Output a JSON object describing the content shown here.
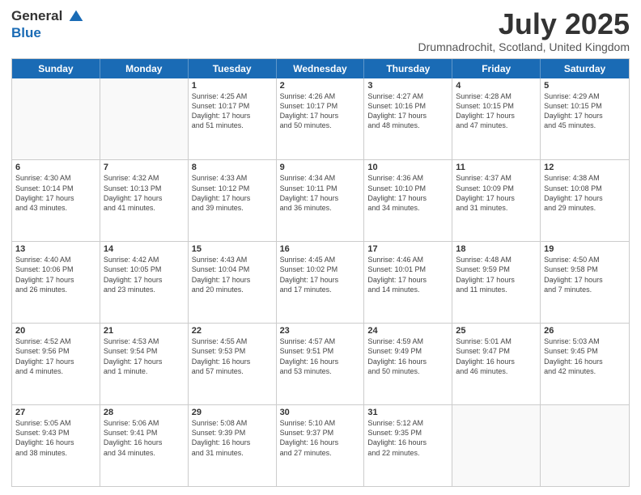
{
  "logo": {
    "general": "General",
    "blue": "Blue"
  },
  "title": "July 2025",
  "location": "Drumnadrochit, Scotland, United Kingdom",
  "days": [
    "Sunday",
    "Monday",
    "Tuesday",
    "Wednesday",
    "Thursday",
    "Friday",
    "Saturday"
  ],
  "weeks": [
    [
      {
        "day": "",
        "info": ""
      },
      {
        "day": "",
        "info": ""
      },
      {
        "day": "1",
        "info": "Sunrise: 4:25 AM\nSunset: 10:17 PM\nDaylight: 17 hours\nand 51 minutes."
      },
      {
        "day": "2",
        "info": "Sunrise: 4:26 AM\nSunset: 10:17 PM\nDaylight: 17 hours\nand 50 minutes."
      },
      {
        "day": "3",
        "info": "Sunrise: 4:27 AM\nSunset: 10:16 PM\nDaylight: 17 hours\nand 48 minutes."
      },
      {
        "day": "4",
        "info": "Sunrise: 4:28 AM\nSunset: 10:15 PM\nDaylight: 17 hours\nand 47 minutes."
      },
      {
        "day": "5",
        "info": "Sunrise: 4:29 AM\nSunset: 10:15 PM\nDaylight: 17 hours\nand 45 minutes."
      }
    ],
    [
      {
        "day": "6",
        "info": "Sunrise: 4:30 AM\nSunset: 10:14 PM\nDaylight: 17 hours\nand 43 minutes."
      },
      {
        "day": "7",
        "info": "Sunrise: 4:32 AM\nSunset: 10:13 PM\nDaylight: 17 hours\nand 41 minutes."
      },
      {
        "day": "8",
        "info": "Sunrise: 4:33 AM\nSunset: 10:12 PM\nDaylight: 17 hours\nand 39 minutes."
      },
      {
        "day": "9",
        "info": "Sunrise: 4:34 AM\nSunset: 10:11 PM\nDaylight: 17 hours\nand 36 minutes."
      },
      {
        "day": "10",
        "info": "Sunrise: 4:36 AM\nSunset: 10:10 PM\nDaylight: 17 hours\nand 34 minutes."
      },
      {
        "day": "11",
        "info": "Sunrise: 4:37 AM\nSunset: 10:09 PM\nDaylight: 17 hours\nand 31 minutes."
      },
      {
        "day": "12",
        "info": "Sunrise: 4:38 AM\nSunset: 10:08 PM\nDaylight: 17 hours\nand 29 minutes."
      }
    ],
    [
      {
        "day": "13",
        "info": "Sunrise: 4:40 AM\nSunset: 10:06 PM\nDaylight: 17 hours\nand 26 minutes."
      },
      {
        "day": "14",
        "info": "Sunrise: 4:42 AM\nSunset: 10:05 PM\nDaylight: 17 hours\nand 23 minutes."
      },
      {
        "day": "15",
        "info": "Sunrise: 4:43 AM\nSunset: 10:04 PM\nDaylight: 17 hours\nand 20 minutes."
      },
      {
        "day": "16",
        "info": "Sunrise: 4:45 AM\nSunset: 10:02 PM\nDaylight: 17 hours\nand 17 minutes."
      },
      {
        "day": "17",
        "info": "Sunrise: 4:46 AM\nSunset: 10:01 PM\nDaylight: 17 hours\nand 14 minutes."
      },
      {
        "day": "18",
        "info": "Sunrise: 4:48 AM\nSunset: 9:59 PM\nDaylight: 17 hours\nand 11 minutes."
      },
      {
        "day": "19",
        "info": "Sunrise: 4:50 AM\nSunset: 9:58 PM\nDaylight: 17 hours\nand 7 minutes."
      }
    ],
    [
      {
        "day": "20",
        "info": "Sunrise: 4:52 AM\nSunset: 9:56 PM\nDaylight: 17 hours\nand 4 minutes."
      },
      {
        "day": "21",
        "info": "Sunrise: 4:53 AM\nSunset: 9:54 PM\nDaylight: 17 hours\nand 1 minute."
      },
      {
        "day": "22",
        "info": "Sunrise: 4:55 AM\nSunset: 9:53 PM\nDaylight: 16 hours\nand 57 minutes."
      },
      {
        "day": "23",
        "info": "Sunrise: 4:57 AM\nSunset: 9:51 PM\nDaylight: 16 hours\nand 53 minutes."
      },
      {
        "day": "24",
        "info": "Sunrise: 4:59 AM\nSunset: 9:49 PM\nDaylight: 16 hours\nand 50 minutes."
      },
      {
        "day": "25",
        "info": "Sunrise: 5:01 AM\nSunset: 9:47 PM\nDaylight: 16 hours\nand 46 minutes."
      },
      {
        "day": "26",
        "info": "Sunrise: 5:03 AM\nSunset: 9:45 PM\nDaylight: 16 hours\nand 42 minutes."
      }
    ],
    [
      {
        "day": "27",
        "info": "Sunrise: 5:05 AM\nSunset: 9:43 PM\nDaylight: 16 hours\nand 38 minutes."
      },
      {
        "day": "28",
        "info": "Sunrise: 5:06 AM\nSunset: 9:41 PM\nDaylight: 16 hours\nand 34 minutes."
      },
      {
        "day": "29",
        "info": "Sunrise: 5:08 AM\nSunset: 9:39 PM\nDaylight: 16 hours\nand 31 minutes."
      },
      {
        "day": "30",
        "info": "Sunrise: 5:10 AM\nSunset: 9:37 PM\nDaylight: 16 hours\nand 27 minutes."
      },
      {
        "day": "31",
        "info": "Sunrise: 5:12 AM\nSunset: 9:35 PM\nDaylight: 16 hours\nand 22 minutes."
      },
      {
        "day": "",
        "info": ""
      },
      {
        "day": "",
        "info": ""
      }
    ]
  ]
}
